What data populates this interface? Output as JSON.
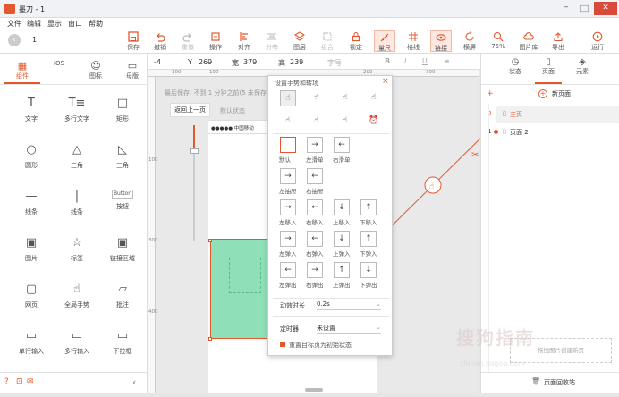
{
  "window": {
    "title": "墨刀 - 1"
  },
  "menu": [
    "文件",
    "编辑",
    "显示",
    "窗口",
    "帮助"
  ],
  "page_number": "1",
  "toolbar": {
    "save": "保存",
    "undo": "撤销",
    "redo": "重做",
    "operate": "操作",
    "align": "对齐",
    "distribute": "分布",
    "layer": "图层",
    "group": "组合",
    "lock": "锁定",
    "ruler": "量尺",
    "grid": "格线",
    "link": "链接",
    "landscape": "横屏",
    "zoom": "75%",
    "image_lib": "图片库",
    "export": "导出",
    "run": "运行"
  },
  "props": {
    "x": "-4",
    "y_label": "Y",
    "y": "269",
    "w_label": "宽",
    "w": "379",
    "h_label": "高",
    "h": "239",
    "font_label": "字号",
    "ruler_min": "-100"
  },
  "left_tabs": [
    "组件",
    "iOS",
    "图标",
    "母版"
  ],
  "components": [
    "文字",
    "多行文字",
    "矩形",
    "圆形",
    "三角",
    "三角",
    "线条",
    "线条",
    "按钮",
    "图片",
    "标签",
    "链接区域",
    "网页",
    "全局手势",
    "批注",
    "单行输入",
    "多行输入",
    "下拉框"
  ],
  "button_component_caption": "Button",
  "canvas": {
    "autosave": "最后保存: 不到 1 分钟之前(5 未保存)",
    "back_button": "返回上一页",
    "default_state": "默认状态",
    "status_bar": "●●●●● 中国移动",
    "rulers": [
      "100",
      "200",
      "300",
      "400"
    ]
  },
  "popup": {
    "title": "设置手势和转场",
    "transitions": [
      "默认",
      "左滑单",
      "右滑单",
      "左抽屉",
      "右抽屉",
      "左移入",
      "右移入",
      "上移入",
      "下移入",
      "左弹入",
      "右弹入",
      "上弹入",
      "下弹入",
      "左弹出",
      "右弹出",
      "上弹出",
      "下弹出"
    ],
    "duration_label": "动效时长",
    "duration_value": "0.2s",
    "timer_label": "定时器",
    "timer_value": "未设置",
    "reset_label": "重置目标页为初始状态"
  },
  "right_panel": {
    "tabs": [
      "状态",
      "页面",
      "元素"
    ],
    "new_page": "新页面",
    "pages": [
      {
        "index": "0",
        "name": "主页"
      },
      {
        "index": "1",
        "name": "页面 2"
      }
    ],
    "hint": "拖拽图片创建新页",
    "recycle": "页面回收站"
  },
  "watermark": "搜狗指南",
  "watermark_url": "zhinan.sogou.com",
  "colors": {
    "accent": "#e4572e",
    "selection": "#8fe0b8"
  }
}
